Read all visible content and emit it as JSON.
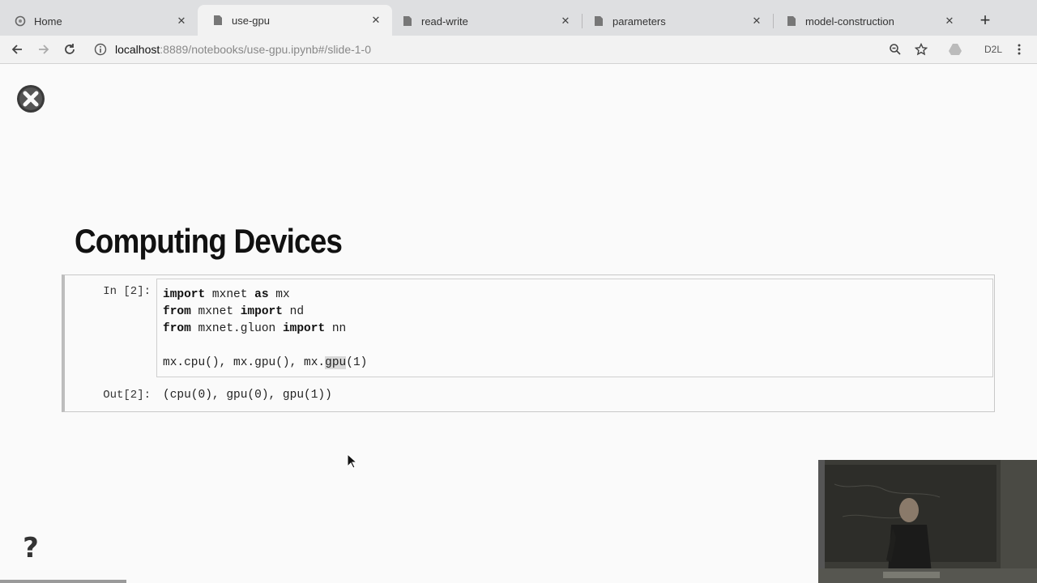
{
  "browser": {
    "tabs": [
      {
        "label": "Home",
        "icon": "jupyter-icon",
        "active": false
      },
      {
        "label": "use-gpu",
        "icon": "notebook-icon",
        "active": true
      },
      {
        "label": "read-write",
        "icon": "notebook-icon",
        "active": false
      },
      {
        "label": "parameters",
        "icon": "notebook-icon",
        "active": false
      },
      {
        "label": "model-construction",
        "icon": "notebook-icon",
        "active": false
      }
    ],
    "url_host": "localhost",
    "url_path": ":8889/notebooks/use-gpu.ipynb#/slide-1-0",
    "extension_label": "D2L"
  },
  "slide": {
    "title": "Computing Devices",
    "cell": {
      "in_prompt": "In [2]:",
      "out_prompt": "Out[2]:",
      "code": {
        "line1": {
          "kw1": "import",
          "t1": " mxnet ",
          "kw2": "as",
          "t2": " mx"
        },
        "line2": {
          "kw1": "from",
          "t1": " mxnet ",
          "kw2": "import",
          "t2": " nd"
        },
        "line3": {
          "kw1": "from",
          "t1": " mxnet.gluon ",
          "kw2": "import",
          "t2": " nn"
        },
        "line5": {
          "pre": "mx.cpu(), mx.gpu(), mx.",
          "highlight": "gpu",
          "post": "(1)"
        }
      },
      "output": "(cpu(0), gpu(0), gpu(1))"
    },
    "help_glyph": "?"
  }
}
